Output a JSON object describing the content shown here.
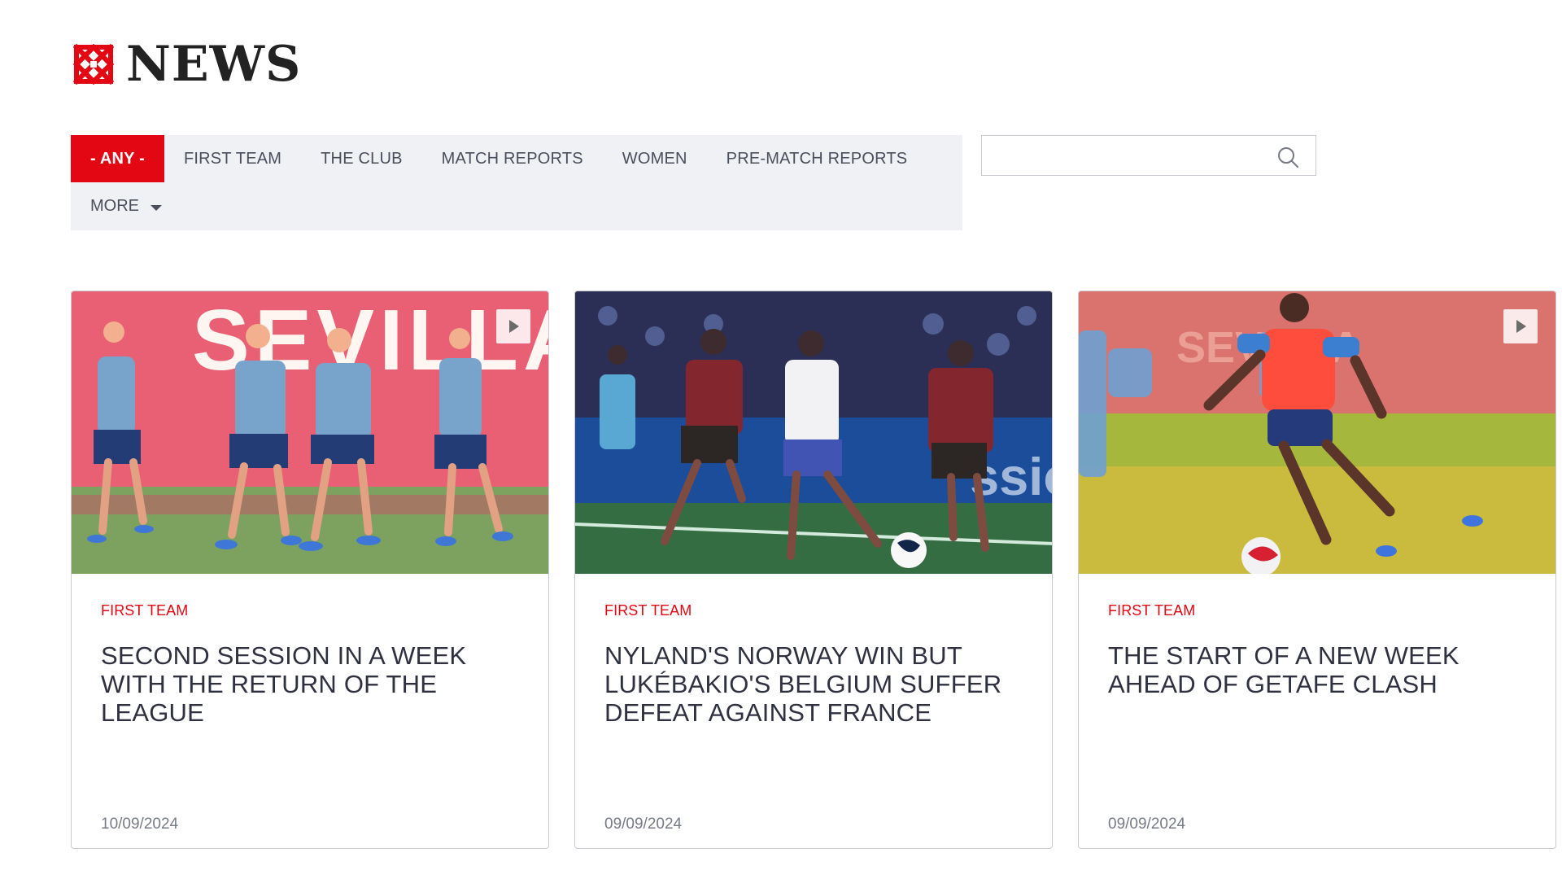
{
  "header": {
    "title": "NEWS",
    "logo_icon": "sevilla-knot-icon",
    "accent_color": "#e30613"
  },
  "filters": {
    "active": "- ANY -",
    "items": [
      "FIRST TEAM",
      "THE CLUB",
      "MATCH REPORTS",
      "WOMEN",
      "PRE-MATCH REPORTS"
    ],
    "more": "MORE"
  },
  "search": {
    "placeholder": ""
  },
  "cards": [
    {
      "category": "FIRST TEAM",
      "headline": "SECOND SESSION IN A WEEK WITH THE RETURN OF THE LEAGUE",
      "date": "10/09/2024",
      "image_text": "SEVILLA",
      "has_video": true
    },
    {
      "category": "FIRST TEAM",
      "headline": "NYLAND'S NORWAY WIN BUT LUKÉBAKIO'S BELGIUM SUFFER DEFEAT AGAINST FRANCE",
      "date": "09/09/2024",
      "image_text": "",
      "has_video": false
    },
    {
      "category": "FIRST TEAM",
      "headline": "THE START OF A NEW WEEK AHEAD OF GETAFE CLASH",
      "date": "09/09/2024",
      "image_text": "SEVILLA",
      "has_video": true
    }
  ]
}
